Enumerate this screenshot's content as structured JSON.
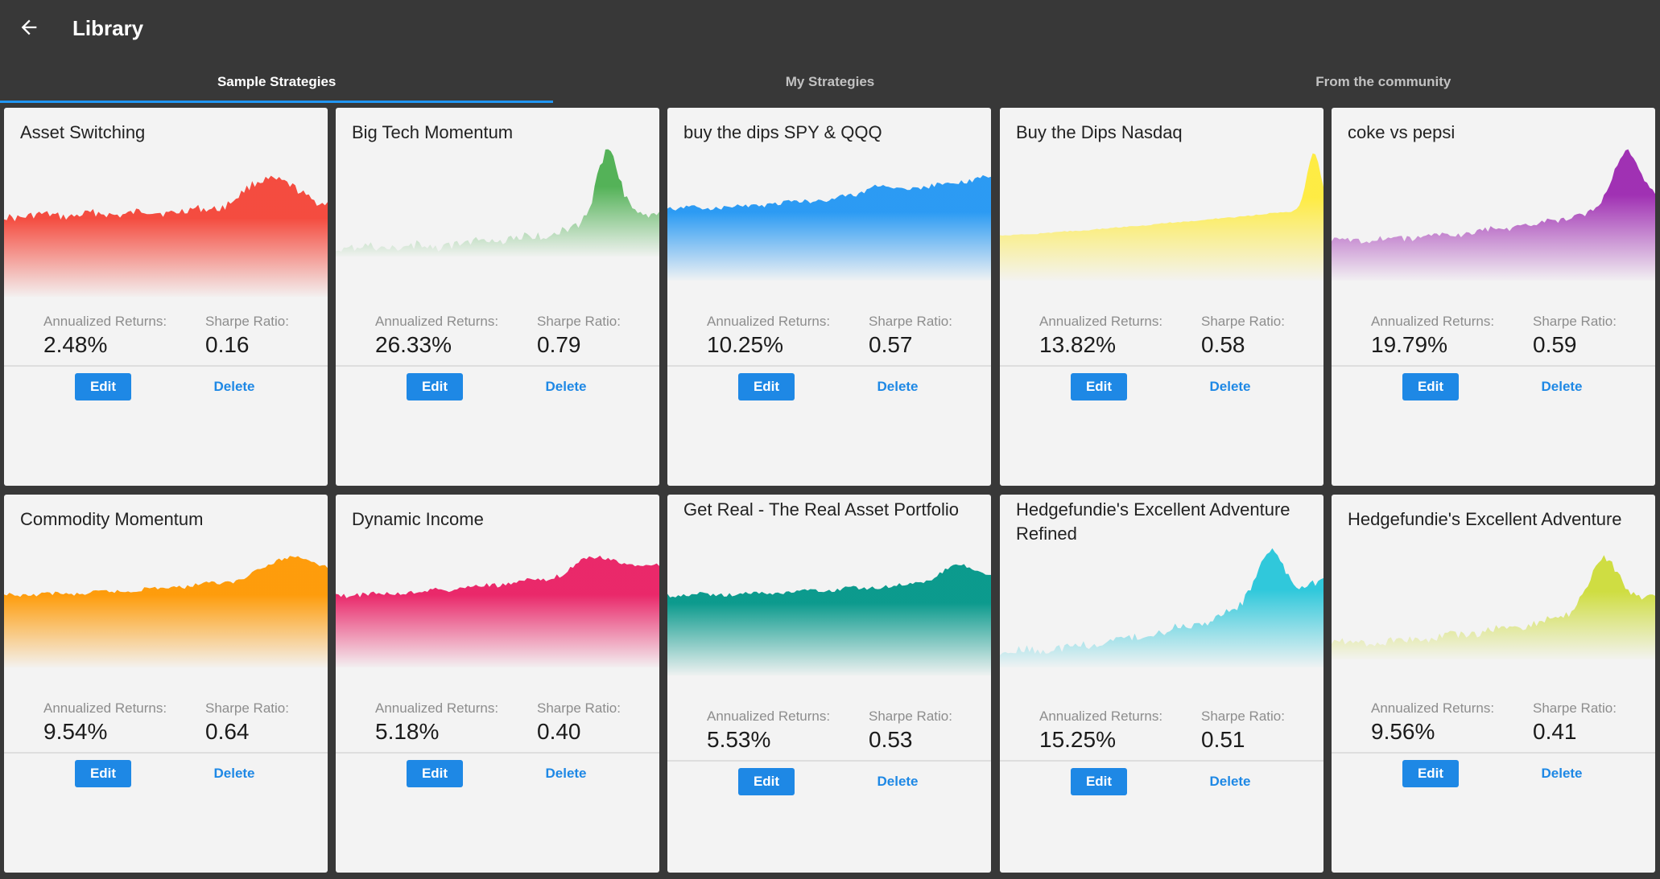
{
  "app": {
    "title": "Library",
    "back_icon": "arrow-left-icon"
  },
  "tabs": [
    {
      "label": "Sample Strategies",
      "active": true
    },
    {
      "label": "My Strategies",
      "active": false
    },
    {
      "label": "From the community",
      "active": false
    }
  ],
  "labels": {
    "returns": "Annualized Returns:",
    "sharpe": "Sharpe Ratio:",
    "edit": "Edit",
    "delete": "Delete"
  },
  "colors": {
    "accent": "#2196f3",
    "button": "#1e88e5",
    "background": "#383838",
    "card": "#f3f3f3"
  },
  "strategies": [
    {
      "name": "Asset Switching",
      "returns": "2.48%",
      "sharpe": "0.16",
      "color": "#f44336"
    },
    {
      "name": "Big Tech Momentum",
      "returns": "26.33%",
      "sharpe": "0.79",
      "color": "#4caf50"
    },
    {
      "name": "buy the dips SPY & QQQ",
      "returns": "10.25%",
      "sharpe": "0.57",
      "color": "#2196f3"
    },
    {
      "name": "Buy the Dips Nasdaq",
      "returns": "13.82%",
      "sharpe": "0.58",
      "color": "#ffeb3b"
    },
    {
      "name": "coke vs pepsi",
      "returns": "19.79%",
      "sharpe": "0.59",
      "color": "#9c27b0"
    },
    {
      "name": "Commodity Momentum",
      "returns": "9.54%",
      "sharpe": "0.64",
      "color": "#ff9800"
    },
    {
      "name": "Dynamic Income",
      "returns": "5.18%",
      "sharpe": "0.40",
      "color": "#e91e63"
    },
    {
      "name": "Get Real - The Real Asset Portfolio",
      "returns": "5.53%",
      "sharpe": "0.53",
      "color": "#009688"
    },
    {
      "name": "Hedgefundie's Excellent Adventure Refined",
      "returns": "15.25%",
      "sharpe": "0.51",
      "color": "#26c6da"
    },
    {
      "name": "Hedgefundie's Excellent Adventure",
      "returns": "9.56%",
      "sharpe": "0.41",
      "color": "#cddc39"
    }
  ]
}
